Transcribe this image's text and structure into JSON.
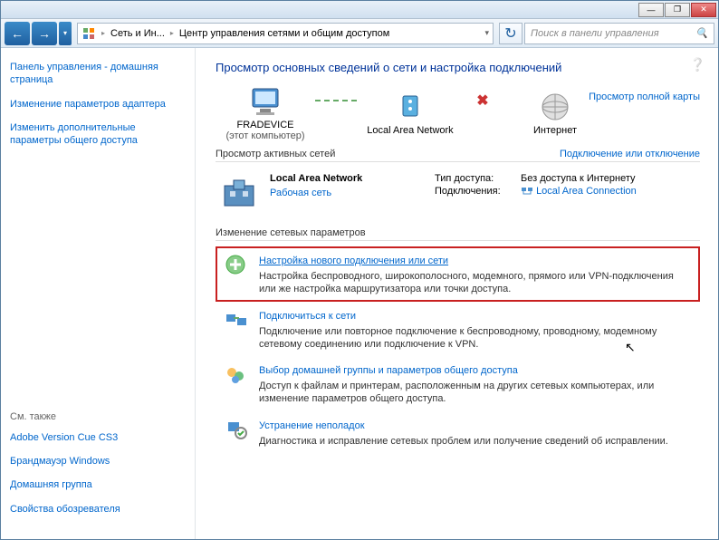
{
  "titlebar": {
    "min": "—",
    "max": "❐",
    "close": "✕"
  },
  "nav": {
    "back": "←",
    "fwd": "→",
    "dd": "▾",
    "crumb1": "Сеть и Ин...",
    "crumb2": "Центр управления сетями и общим доступом",
    "search_placeholder": "Поиск в панели управления"
  },
  "sidebar": {
    "home": "Панель управления - домашняя страница",
    "adapter": "Изменение параметров адаптера",
    "sharing": "Изменить дополнительные параметры общего доступа",
    "see_also": "См. также",
    "link1": "Adobe Version Cue CS3",
    "link2": "Брандмауэр Windows",
    "link3": "Домашняя группа",
    "link4": "Свойства обозревателя"
  },
  "main": {
    "title": "Просмотр основных сведений о сети и настройка подключений",
    "full_map": "Просмотр полной карты",
    "node1": "FRADEVICE",
    "node1_sub": "(этот компьютер)",
    "node2": "Local Area Network",
    "node3": "Интернет",
    "active_hdr": "Просмотр активных сетей",
    "conn_toggle": "Подключение или отключение",
    "net_name": "Local Area Network",
    "net_type": "Рабочая сеть",
    "access_k": "Тип доступа:",
    "access_v": "Без доступа к Интернету",
    "conn_k": "Подключения:",
    "conn_v": "Local Area Connection",
    "change_hdr": "Изменение сетевых параметров",
    "tasks": [
      {
        "title": "Настройка нового подключения или сети",
        "desc": "Настройка беспроводного, широкополосного, модемного, прямого или VPN-подключения или же настройка маршрутизатора или точки доступа."
      },
      {
        "title": "Подключиться к сети",
        "desc": "Подключение или повторное подключение к беспроводному, проводному, модемному сетевому соединению или подключение к VPN."
      },
      {
        "title": "Выбор домашней группы и параметров общего доступа",
        "desc": "Доступ к файлам и принтерам, расположенным на других сетевых компьютерах, или изменение параметров общего доступа."
      },
      {
        "title": "Устранение неполадок",
        "desc": "Диагностика и исправление сетевых проблем или получение сведений об исправлении."
      }
    ]
  }
}
